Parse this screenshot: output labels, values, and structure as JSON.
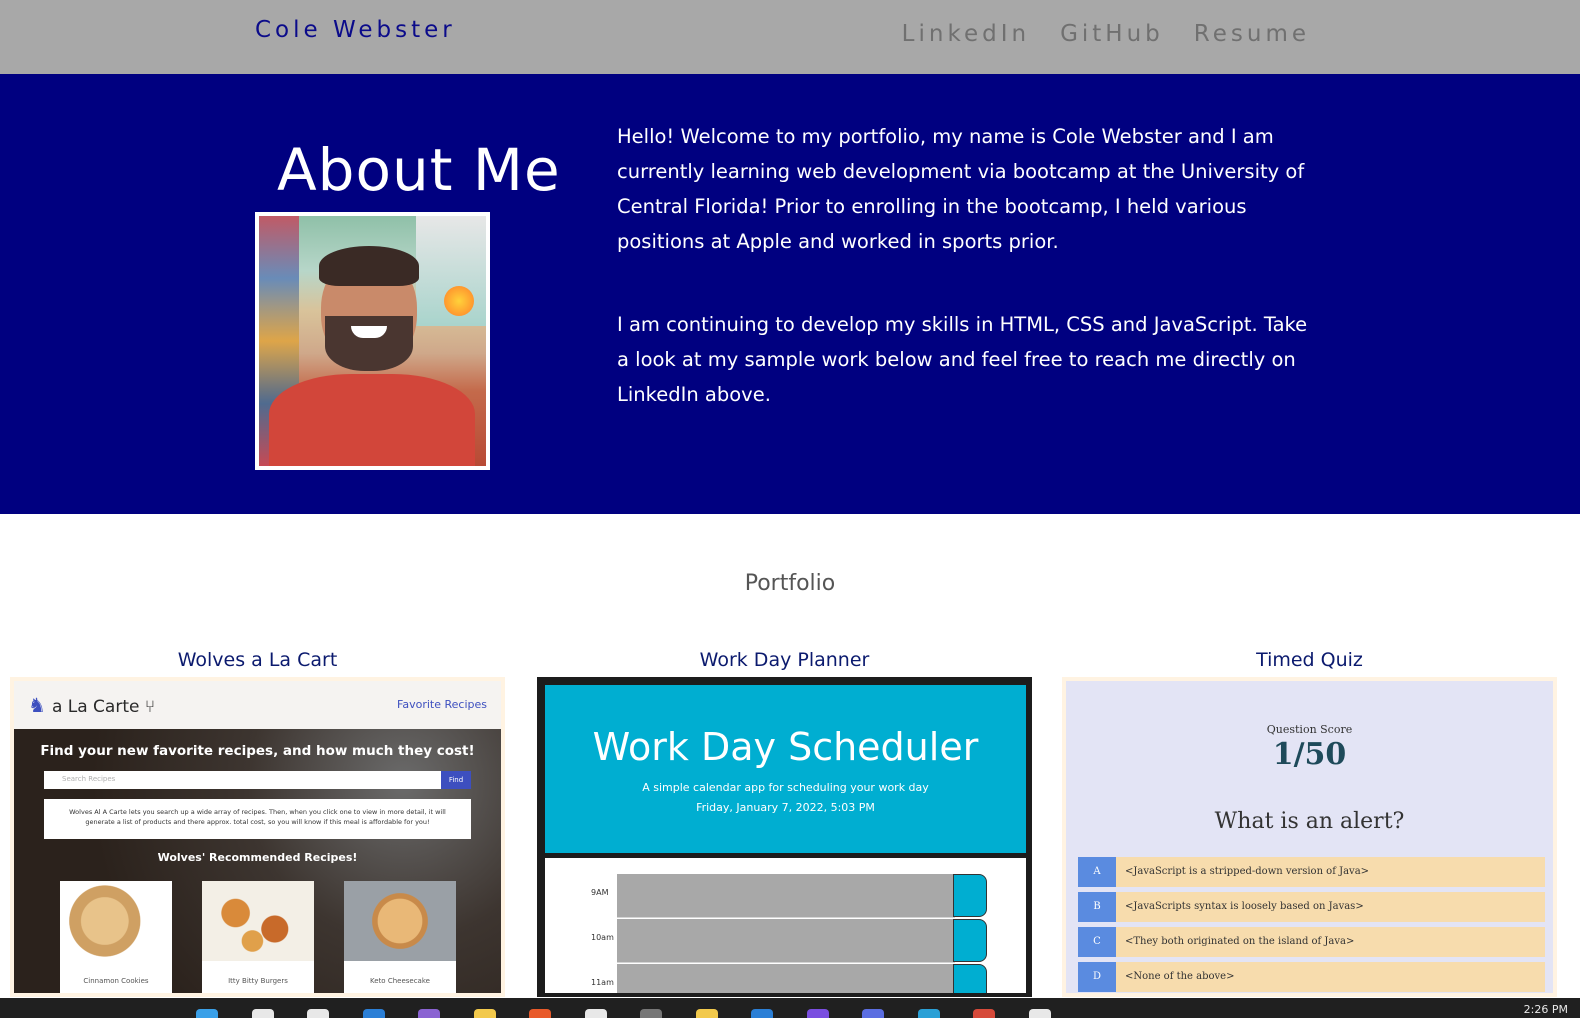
{
  "nav": {
    "brand": "Cole Webster",
    "links": [
      "LinkedIn",
      "GitHub",
      "Resume"
    ]
  },
  "about": {
    "title": "About Me",
    "paragraphs": [
      "Hello! Welcome to my portfolio, my name is Cole Webster and I am currently learning web development via bootcamp at the University of Central Florida! Prior to enrolling in the bootcamp, I held various positions at Apple and worked in sports prior.",
      "I am continuing to develop my skills in HTML, CSS and JavaScript. Take a look at my sample work below and feel free to reach me directly on LinkedIn above."
    ]
  },
  "portfolio": {
    "title": "Portfolio",
    "projects": [
      {
        "title": "Wolves a La Cart",
        "screenshot": {
          "logo": "a La Carte",
          "link": "Favorite Recipes",
          "headline": "Find your new favorite recipes, and how much they cost!",
          "search_placeholder": "Search Recipes",
          "search_button": "Find",
          "description": "Wolves Al A Carte lets you search up a wide array of recipes. Then, when you click one to view in more detail, it will generate a list of products and there approx. total cost, so you will know if this meal is affordable for you!",
          "recommended_heading": "Wolves' Recommended Recipes!",
          "recipes": [
            "Cinnamon Cookies",
            "Itty Bitty Burgers",
            "Keto Cheesecake"
          ]
        }
      },
      {
        "title": "Work Day Planner",
        "screenshot": {
          "title": "Work Day Scheduler",
          "subtitle": "A simple calendar app for scheduling your work day",
          "date": "Friday, January 7, 2022, 5:03 PM",
          "hours": [
            "9AM",
            "10am",
            "11am"
          ]
        }
      },
      {
        "title": "Timed Quiz",
        "screenshot": {
          "score_label": "Question Score",
          "score": "1/50",
          "question": "What is an alert?",
          "options": [
            {
              "letter": "A",
              "text": "<JavaScript is a stripped-down version of Java>"
            },
            {
              "letter": "B",
              "text": "<JavaScripts syntax is loosely based on Javas>"
            },
            {
              "letter": "C",
              "text": "<They both originated on the island of Java>"
            },
            {
              "letter": "D",
              "text": "<None of the above>"
            }
          ]
        }
      }
    ]
  },
  "taskbar": {
    "clock": "2:26 PM",
    "icon_colors": [
      "#3aa0e8",
      "#e8e8e8",
      "#e8e8e8",
      "#2b7fd6",
      "#8a63d2",
      "#f2c94c",
      "#e85a2a",
      "#e8e8e8",
      "#777777",
      "#f2c94c",
      "#2b7fd6",
      "#7a4ee0",
      "#5b6ee1",
      "#2aa0d6",
      "#d64a3a",
      "#e8e8e8"
    ]
  }
}
